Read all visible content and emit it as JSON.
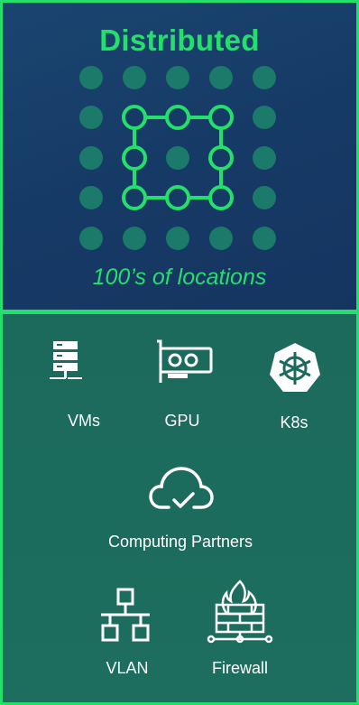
{
  "header": {
    "title": "Distributed",
    "subtitle": "100’s of locations"
  },
  "colors": {
    "accent": "#22e06a",
    "dot": "#1b7a6a",
    "top_bg": "#163a66",
    "bottom_bg": "#1d6a5c"
  },
  "resources": {
    "vms": {
      "label": "VMs",
      "icon": "server-rack-icon"
    },
    "gpu": {
      "label": "GPU",
      "icon": "gpu-card-icon"
    },
    "k8s": {
      "label": "K8s",
      "icon": "kubernetes-icon"
    },
    "partners": {
      "label": "Computing Partners",
      "icon": "cloud-check-icon"
    },
    "vlan": {
      "label": "VLAN",
      "icon": "network-topology-icon"
    },
    "firewall": {
      "label": "Firewall",
      "icon": "firewall-icon"
    }
  }
}
